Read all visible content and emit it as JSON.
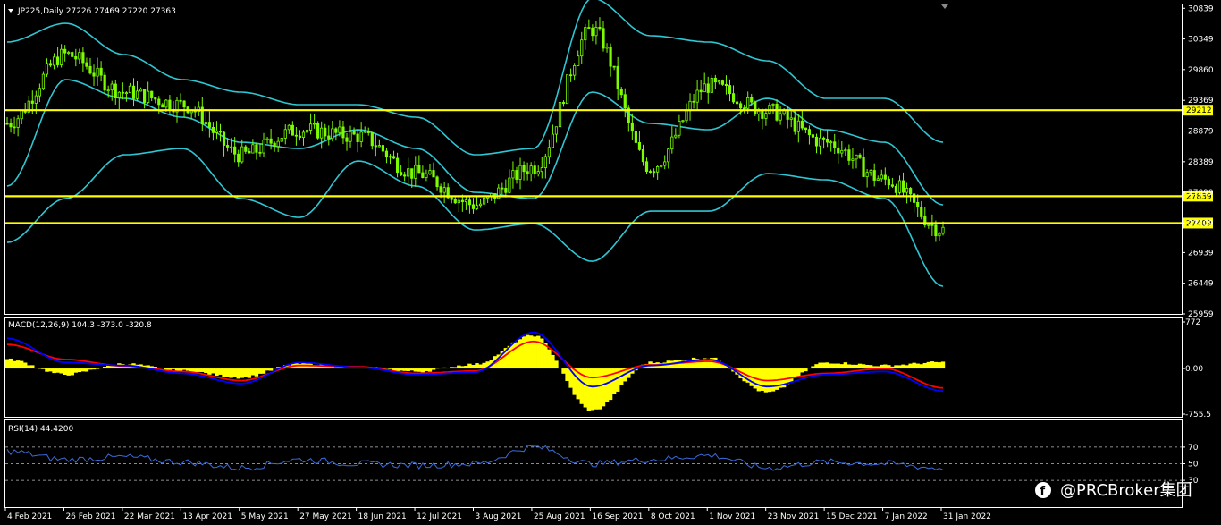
{
  "watermark": "@PRCBroker集团",
  "panes": {
    "main": {
      "label": "JP225,Daily  27226 27469 27220 27363",
      "y_ticks": [
        30839,
        30349,
        29860,
        29369,
        28879,
        28389,
        27899,
        27409,
        26939,
        26449,
        25959
      ],
      "h_lines": [
        {
          "value": 29212,
          "label": "29212",
          "color": "#ffff00"
        },
        {
          "value": 27839,
          "label": "27839",
          "color": "#ffff00"
        },
        {
          "value": 27409,
          "label": "27409",
          "color": "#ffff00"
        }
      ]
    },
    "macd": {
      "label": "MACD(12,26,9) 104.3 -373.0 -320.8",
      "y_ticks": [
        772,
        0.0,
        -755.5
      ],
      "y_tick_labels": [
        "772",
        "0.00",
        "-755.5"
      ]
    },
    "rsi": {
      "label": "RSI(14) 44.4200",
      "y_ticks": [
        70,
        50,
        30
      ],
      "y_tick_labels": [
        "70",
        "50",
        "30"
      ]
    }
  },
  "x_labels": [
    "4 Feb 2021",
    "26 Feb 2021",
    "22 Mar 2021",
    "13 Apr 2021",
    "5 May 2021",
    "27 May 2021",
    "18 Jun 2021",
    "12 Jul 2021",
    "3 Aug 2021",
    "25 Aug 2021",
    "16 Sep 2021",
    "8 Oct 2021",
    "1 Nov 2021",
    "23 Nov 2021",
    "15 Dec 2021",
    "7 Jan 2022",
    "31 Jan 2022"
  ],
  "colors": {
    "candles": "#7cfc00",
    "bollinger": "#2fc6d3",
    "macd_hist": "#ffff00",
    "macd_line": "#0000ff",
    "macd_signal": "#ff0000",
    "rsi_line": "#3a6bd9",
    "levels": "#ffff00",
    "axis": "#ffffff"
  },
  "chart_data": {
    "type": "line",
    "title": "JP225,Daily",
    "ohlc_last": {
      "open": 27226,
      "high": 27469,
      "low": 27220,
      "close": 27363
    },
    "x": [
      "4 Feb 2021",
      "26 Feb 2021",
      "22 Mar 2021",
      "13 Apr 2021",
      "5 May 2021",
      "27 May 2021",
      "18 Jun 2021",
      "12 Jul 2021",
      "3 Aug 2021",
      "25 Aug 2021",
      "16 Sep 2021",
      "8 Oct 2021",
      "1 Nov 2021",
      "23 Nov 2021",
      "15 Dec 2021",
      "7 Jan 2022",
      "31 Jan 2022"
    ],
    "series": [
      {
        "values": [
          29000,
          30100,
          29500,
          29300,
          28500,
          28900,
          28800,
          28200,
          27700,
          28300,
          30500,
          28300,
          29600,
          29200,
          28700,
          28100,
          27300
        ]
      },
      {
        "values": [
          28000,
          29700,
          29400,
          29100,
          28700,
          28600,
          28900,
          28600,
          27900,
          27800,
          29500,
          29000,
          28900,
          29400,
          28900,
          28700,
          27700
        ]
      },
      {
        "values": [
          30300,
          30600,
          30100,
          29700,
          29500,
          29300,
          29300,
          29100,
          28500,
          28600,
          31000,
          30400,
          30300,
          30000,
          29400,
          29400,
          28700
        ]
      },
      {
        "values": [
          27100,
          27800,
          28500,
          28600,
          27800,
          27500,
          28400,
          28000,
          27300,
          27400,
          26800,
          27600,
          27600,
          28200,
          28100,
          27800,
          26400
        ]
      }
    ],
    "macd": {
      "histogram": [
        150,
        -100,
        80,
        -40,
        -150,
        80,
        20,
        -50,
        70,
        550,
        -700,
        100,
        180,
        -400,
        100,
        50,
        104.3
      ],
      "macd": [
        500,
        100,
        50,
        -80,
        -250,
        100,
        20,
        -100,
        -60,
        600,
        -300,
        50,
        150,
        -300,
        -100,
        -50,
        -373.0
      ],
      "signal": [
        400,
        150,
        40,
        -50,
        -200,
        50,
        30,
        -80,
        -40,
        450,
        -150,
        60,
        120,
        -200,
        -80,
        0,
        -320.8
      ],
      "ylim": [
        -755.5,
        772
      ]
    },
    "rsi": {
      "values": [
        65,
        55,
        58,
        52,
        45,
        55,
        50,
        48,
        50,
        70,
        50,
        55,
        60,
        45,
        52,
        50,
        44.42
      ],
      "ylim": [
        0,
        100
      ],
      "levels": [
        70,
        50,
        30
      ]
    },
    "ylim": [
      25959,
      30900
    ]
  }
}
